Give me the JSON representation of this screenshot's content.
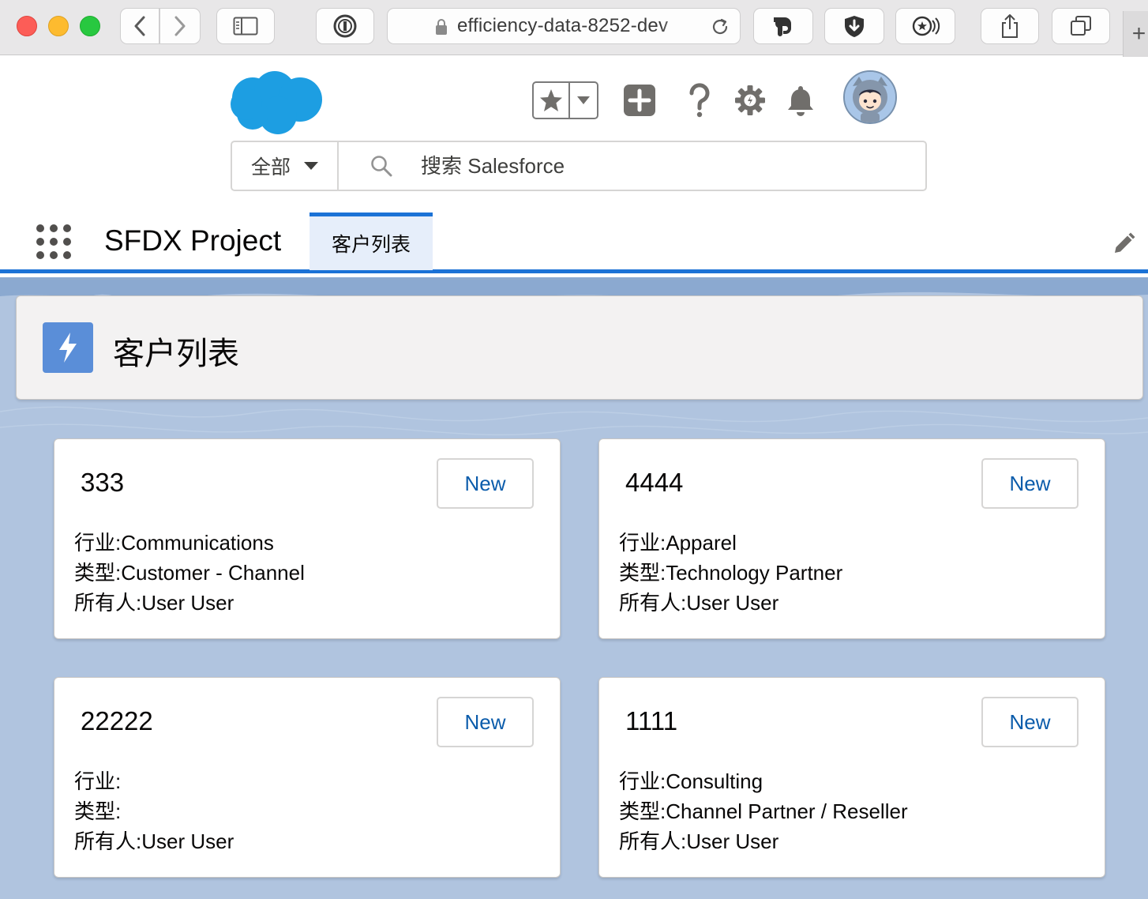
{
  "browser": {
    "url": "efficiency-data-8252-dev",
    "new_tab_label": "+"
  },
  "header": {
    "search_scope": "全部",
    "search_placeholder": "搜索 Salesforce"
  },
  "nav": {
    "app_name": "SFDX Project",
    "tabs": [
      {
        "label": "客户列表",
        "active": true
      }
    ]
  },
  "page": {
    "title": "客户列表"
  },
  "labels": {
    "industry": "行业:",
    "type": "类型:",
    "owner": "所有人:"
  },
  "accounts": [
    {
      "name": "333",
      "button": "New",
      "industry": "行业:Communications",
      "type": "类型:Customer - Channel",
      "owner": "所有人:User User"
    },
    {
      "name": "4444",
      "button": "New",
      "industry": "行业:Apparel",
      "type": "类型:Technology Partner",
      "owner": "所有人:User User"
    },
    {
      "name": "22222",
      "button": "New",
      "industry": "行业:",
      "type": "类型:",
      "owner": "所有人:User User"
    },
    {
      "name": "1111",
      "button": "New",
      "industry": "行业:Consulting",
      "type": "类型:Channel Partner / Reseller",
      "owner": "所有人:User User"
    }
  ],
  "colors": {
    "brand_blue": "#1b72d6",
    "cloud_blue": "#1d9ee2",
    "page_background": "#b0c4df",
    "button_text": "#0b5cab",
    "tab_active_bg": "#e6eefa",
    "header_icon_bg": "#5a8ed8"
  },
  "icons": {
    "header": [
      "favorites-star-icon",
      "chevron-down-icon",
      "add-icon",
      "help-icon",
      "setup-gear-icon",
      "notification-bell-icon"
    ],
    "page": "lightning-bolt-icon"
  }
}
